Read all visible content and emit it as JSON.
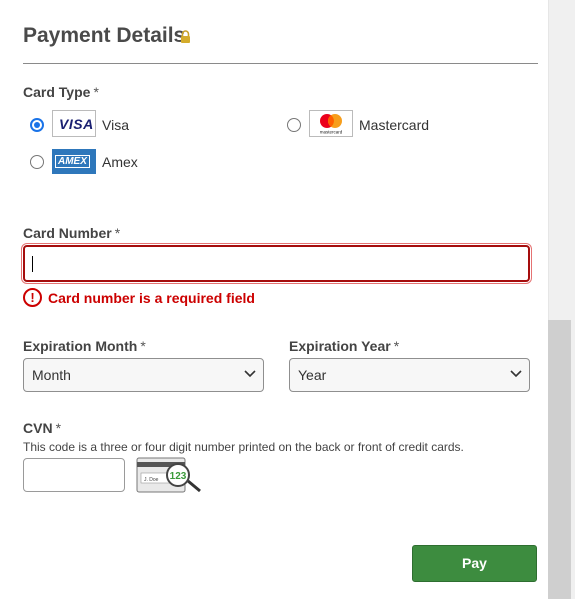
{
  "section": {
    "title": "Payment Details"
  },
  "card_type": {
    "label": "Card Type",
    "required_mark": "*",
    "options": [
      {
        "label": "Visa",
        "logo_text": "VISA",
        "selected": true
      },
      {
        "label": "Mastercard",
        "logo_text": "mastercard",
        "selected": false
      },
      {
        "label": "Amex",
        "logo_text": "AMEX",
        "selected": false
      }
    ]
  },
  "card_number": {
    "label": "Card Number",
    "required_mark": "*",
    "value": "",
    "error": "Card number is a required field",
    "error_icon": "!"
  },
  "expiration_month": {
    "label": "Expiration Month",
    "required_mark": "*",
    "selected": "Month"
  },
  "expiration_year": {
    "label": "Expiration Year",
    "required_mark": "*",
    "selected": "Year"
  },
  "cvn": {
    "label": "CVN",
    "required_mark": "*",
    "help": "This code is a three or four digit number printed on the back or front of credit cards.",
    "value": "",
    "image_text": "123",
    "sig_text": "J. Doe"
  },
  "pay_button": {
    "label": "Pay"
  },
  "colors": {
    "accent": "#1a73e8",
    "error": "#cc0000",
    "pay": "#3d8c3f"
  },
  "icons": {
    "lock": "lock-icon",
    "select": "chevron-down-icon",
    "error": "error-circle-icon"
  }
}
